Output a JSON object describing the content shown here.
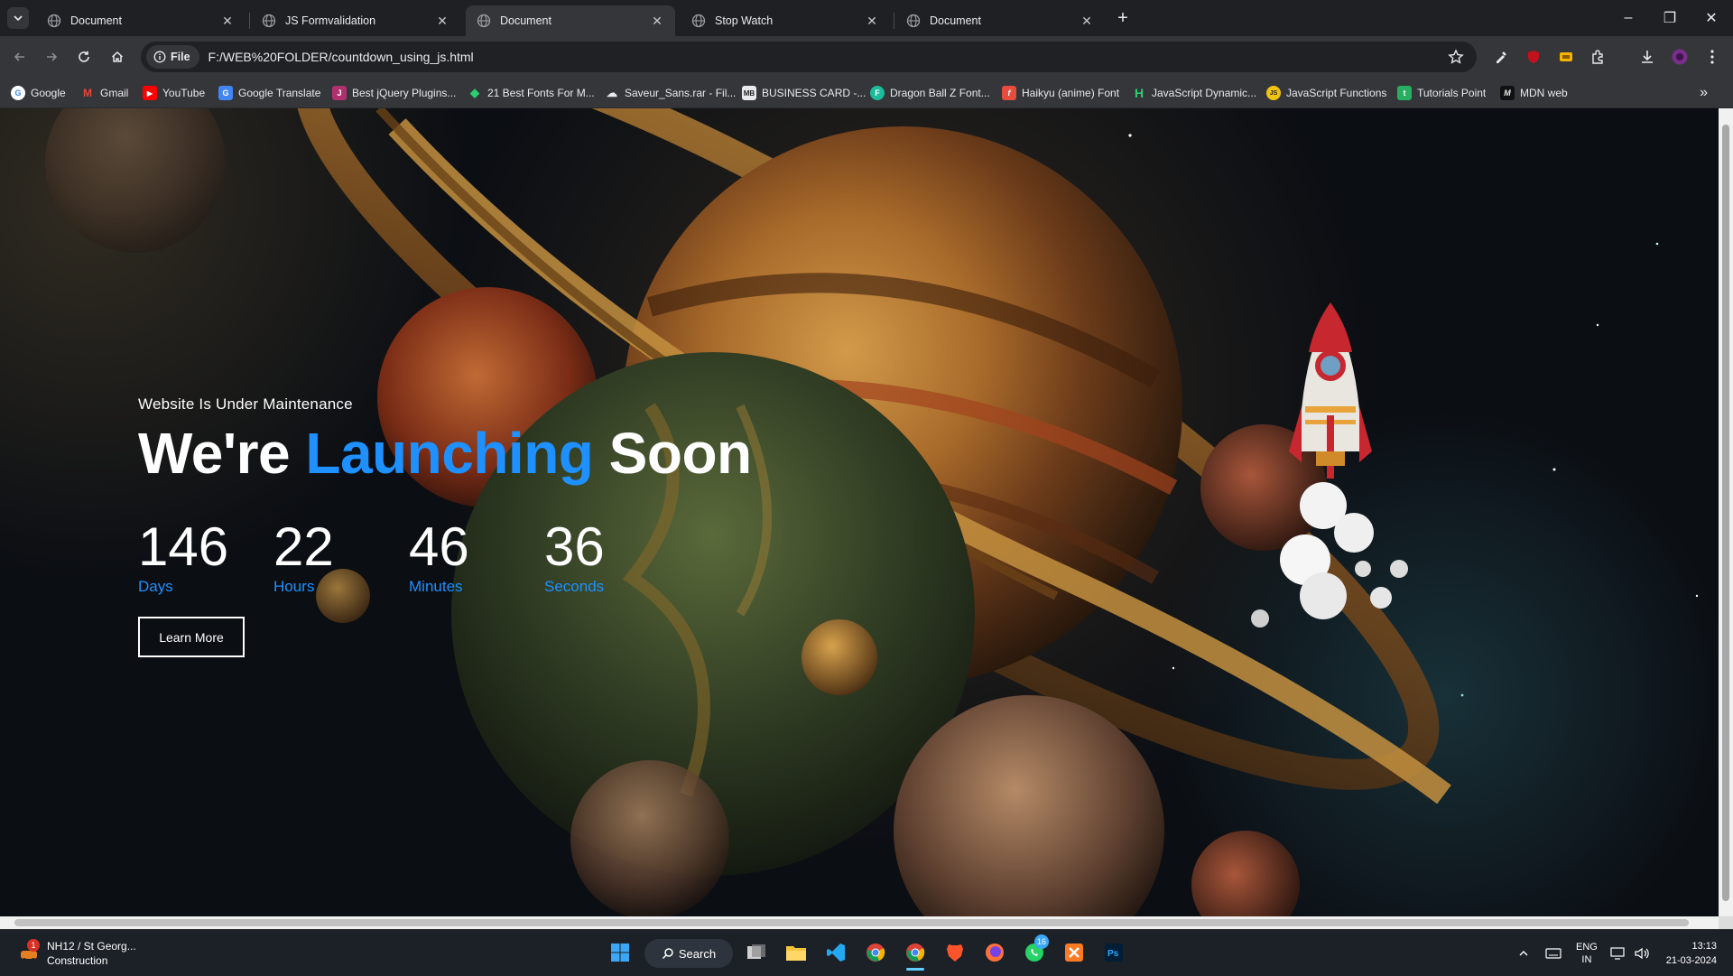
{
  "browser": {
    "tabs": [
      {
        "title": "Document",
        "active": false
      },
      {
        "title": "JS Formvalidation",
        "active": false
      },
      {
        "title": "Document",
        "active": true
      },
      {
        "title": "Stop Watch",
        "active": false
      },
      {
        "title": "Document",
        "active": false
      }
    ],
    "new_tab_label": "+",
    "window_controls": {
      "minimize": "–",
      "restore": "❐",
      "close": "✕"
    },
    "address": {
      "scheme_chip": "File",
      "url": "F:/WEB%20FOLDER/countdown_using_js.html"
    },
    "bookmarks": [
      {
        "label": "Google",
        "icon": "google-icon",
        "color": "#ffffff"
      },
      {
        "label": "Gmail",
        "icon": "gmail-icon",
        "color": "#ea4335"
      },
      {
        "label": "YouTube",
        "icon": "youtube-icon",
        "color": "#ff0000"
      },
      {
        "label": "Google Translate",
        "icon": "translate-icon",
        "color": "#4285f4"
      },
      {
        "label": "Best jQuery Plugins...",
        "icon": "jquery-icon",
        "color": "#b0306e"
      },
      {
        "label": "21 Best Fonts For M...",
        "icon": "tag-icon",
        "color": "#2ecc71"
      },
      {
        "label": "Saveur_Sans.rar - Fil...",
        "icon": "cloud-icon",
        "color": "#444444"
      },
      {
        "label": "BUSINESS CARD -...",
        "icon": "mb-icon",
        "color": "#e8eaed"
      },
      {
        "label": "Dragon Ball Z Font...",
        "icon": "font-icon",
        "color": "#1abc9c"
      },
      {
        "label": "Haikyu (anime) Font",
        "icon": "f-icon",
        "color": "#e74c3c"
      },
      {
        "label": "JavaScript Dynamic...",
        "icon": "h-icon",
        "color": "#2ecc71"
      },
      {
        "label": "JavaScript Functions",
        "icon": "js-icon",
        "color": "#f1c40f"
      },
      {
        "label": "Tutorials Point",
        "icon": "tp-icon",
        "color": "#27ae60"
      },
      {
        "label": "MDN web",
        "icon": "mdn-icon",
        "color": "#111111"
      }
    ]
  },
  "page": {
    "kicker": "Website Is Under Maintenance",
    "headline_start": "We're",
    "headline_accent": "Launching",
    "headline_end": "Soon",
    "accent_color": "#1e90ff",
    "countdown": [
      {
        "value": "146",
        "unit": "Days"
      },
      {
        "value": "22",
        "unit": "Hours"
      },
      {
        "value": "46",
        "unit": "Minutes"
      },
      {
        "value": "36",
        "unit": "Seconds"
      }
    ],
    "cta_label": "Learn More"
  },
  "taskbar": {
    "weather": {
      "badge": "1",
      "line1": "NH12 / St Georg...",
      "line2": "Construction"
    },
    "search_label": "Search",
    "whatsapp_badge": "16",
    "tray": {
      "lang_line1": "ENG",
      "lang_line2": "IN"
    },
    "clock": {
      "time": "13:13",
      "date": "21-03-2024"
    }
  }
}
